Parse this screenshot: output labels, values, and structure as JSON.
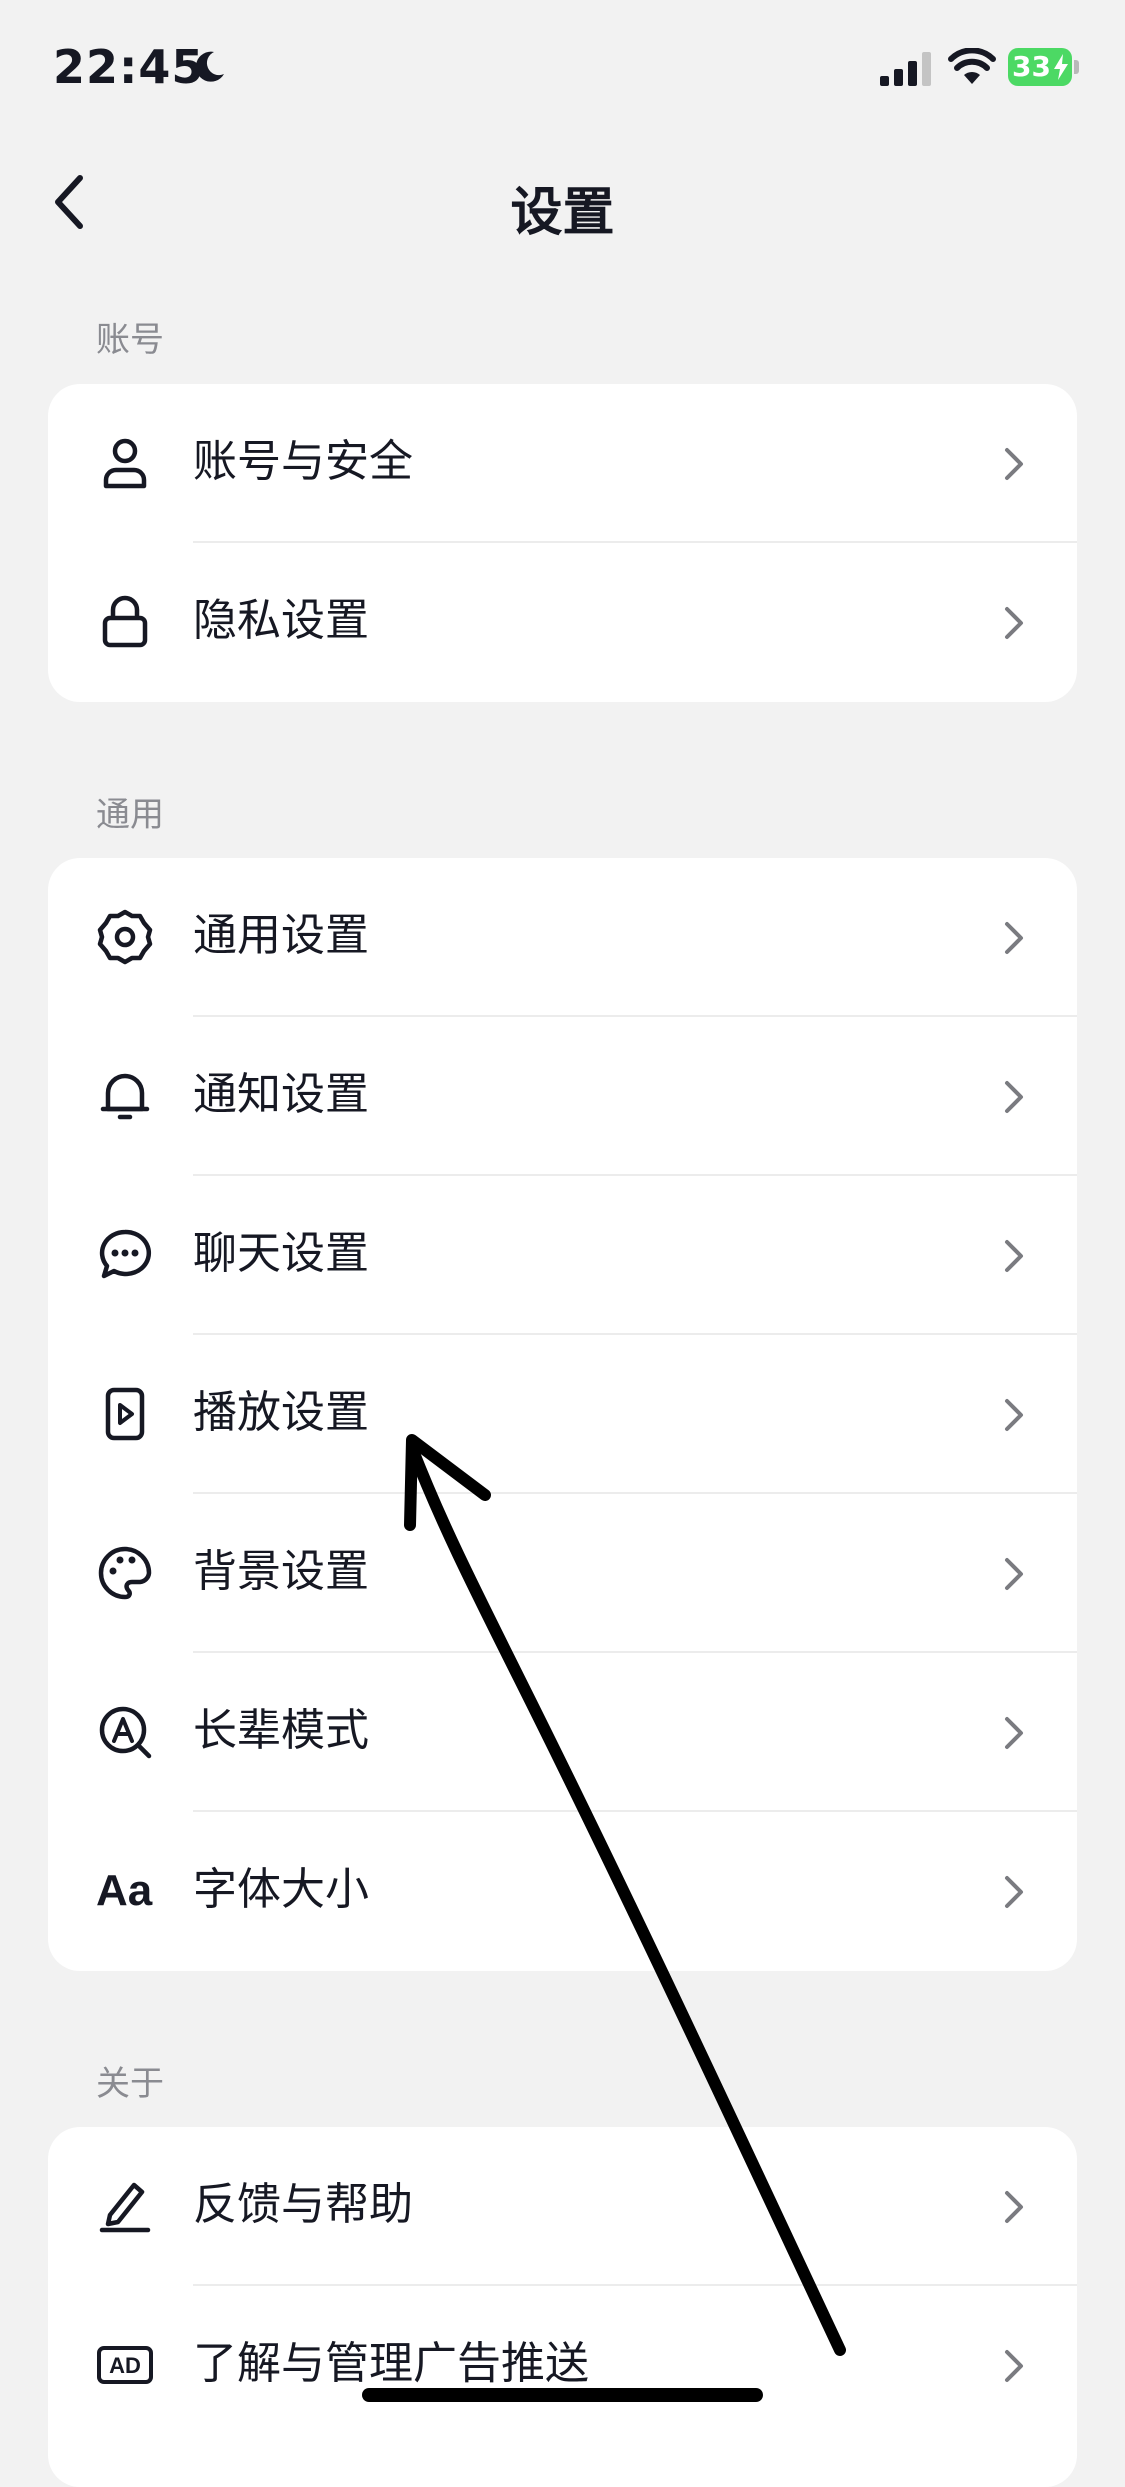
{
  "status_bar": {
    "time": "22:45",
    "battery": "33"
  },
  "header": {
    "title": "设置"
  },
  "sections": [
    {
      "title": "账号",
      "items": [
        {
          "label": "账号与安全",
          "icon": "person-icon"
        },
        {
          "label": "隐私设置",
          "icon": "lock-icon"
        }
      ]
    },
    {
      "title": "通用",
      "items": [
        {
          "label": "通用设置",
          "icon": "gear-icon"
        },
        {
          "label": "通知设置",
          "icon": "bell-icon"
        },
        {
          "label": "聊天设置",
          "icon": "chat-bubble-icon"
        },
        {
          "label": "播放设置",
          "icon": "play-icon"
        },
        {
          "label": "背景设置",
          "icon": "palette-icon"
        },
        {
          "label": "长辈模式",
          "icon": "elder-mode-icon"
        },
        {
          "label": "字体大小",
          "icon": "font-size-icon",
          "icon_text": "Aa"
        }
      ]
    },
    {
      "title": "关于",
      "items": [
        {
          "label": "反馈与帮助",
          "icon": "edit-icon"
        },
        {
          "label": "了解与管理广告推送",
          "icon": "ad-icon",
          "icon_text": "AD"
        }
      ]
    }
  ],
  "colors": {
    "background": "#f2f2f2",
    "card": "#ffffff",
    "text": "#161823",
    "section_text": "#8a8b91",
    "battery": "#4cd964"
  }
}
